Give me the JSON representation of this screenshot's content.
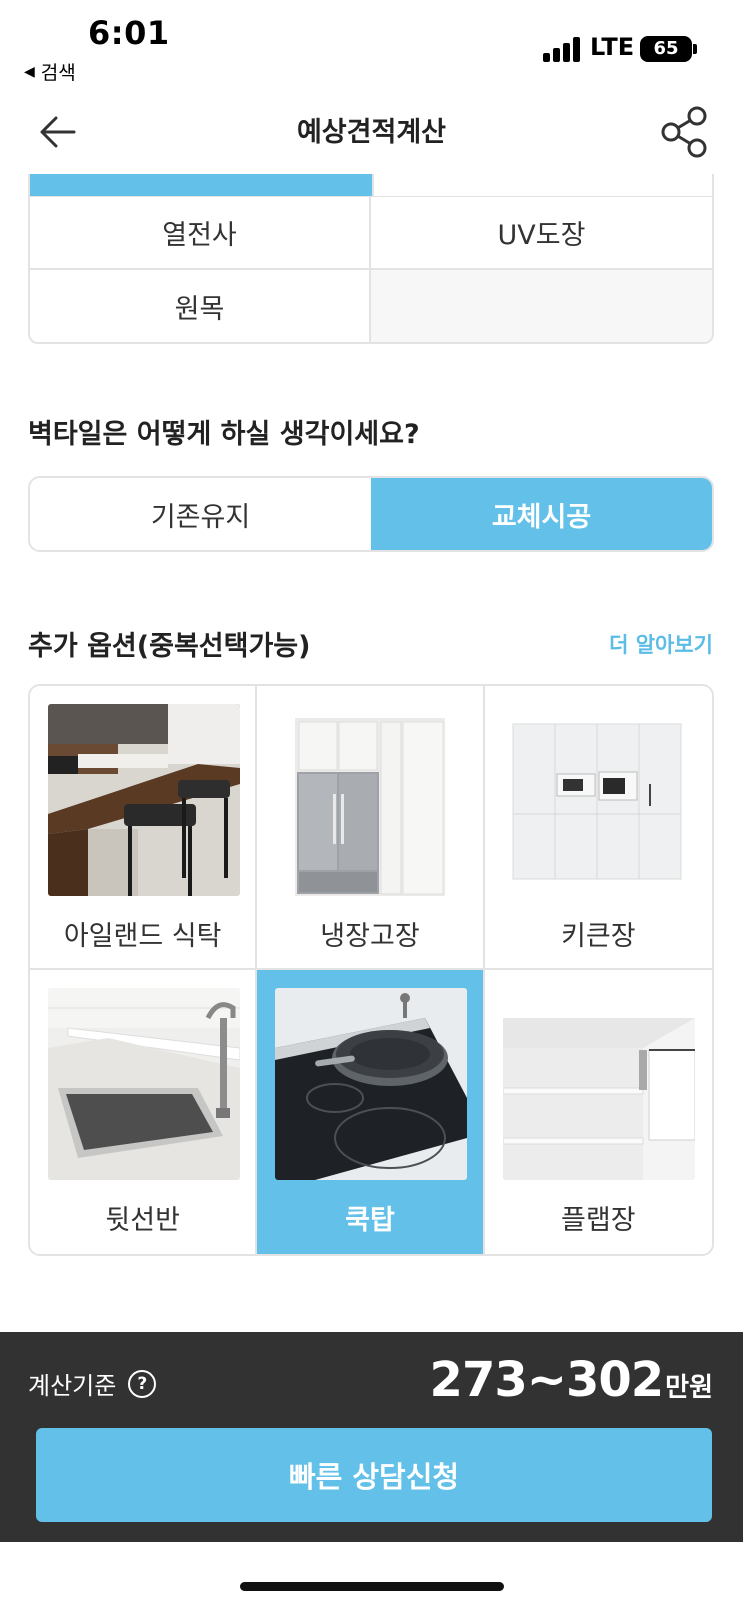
{
  "status_bar": {
    "time": "6:01",
    "back_app": "검색",
    "network": "LTE",
    "battery": "65"
  },
  "header": {
    "title": "예상견적계산",
    "back_icon": "arrow-left-icon",
    "share_icon": "share-icon"
  },
  "materials": {
    "cells": [
      "열전사",
      "UV도장",
      "원목",
      ""
    ]
  },
  "wall_tile": {
    "question": "벽타일은 어떻게 하실 생각이세요?",
    "options": [
      "기존유지",
      "교체시공"
    ],
    "selected": "교체시공"
  },
  "extra_options": {
    "title": "추가 옵션(중복선택가능)",
    "more_link": "더 알아보기",
    "items": [
      {
        "label": "아일랜드 식탁",
        "selected": false
      },
      {
        "label": "냉장고장",
        "selected": false
      },
      {
        "label": "키큰장",
        "selected": false
      },
      {
        "label": "뒷선반",
        "selected": false
      },
      {
        "label": "쿡탑",
        "selected": true
      },
      {
        "label": "플랩장",
        "selected": false
      }
    ]
  },
  "bottom": {
    "calc_label": "계산기준",
    "help_icon": "question-circle-icon",
    "price": "273~302",
    "unit": "만원",
    "cta": "빠른 상담신청"
  },
  "colors": {
    "accent": "#63c1e9",
    "bottom_bar": "#323232",
    "border": "#e3e3e3"
  }
}
